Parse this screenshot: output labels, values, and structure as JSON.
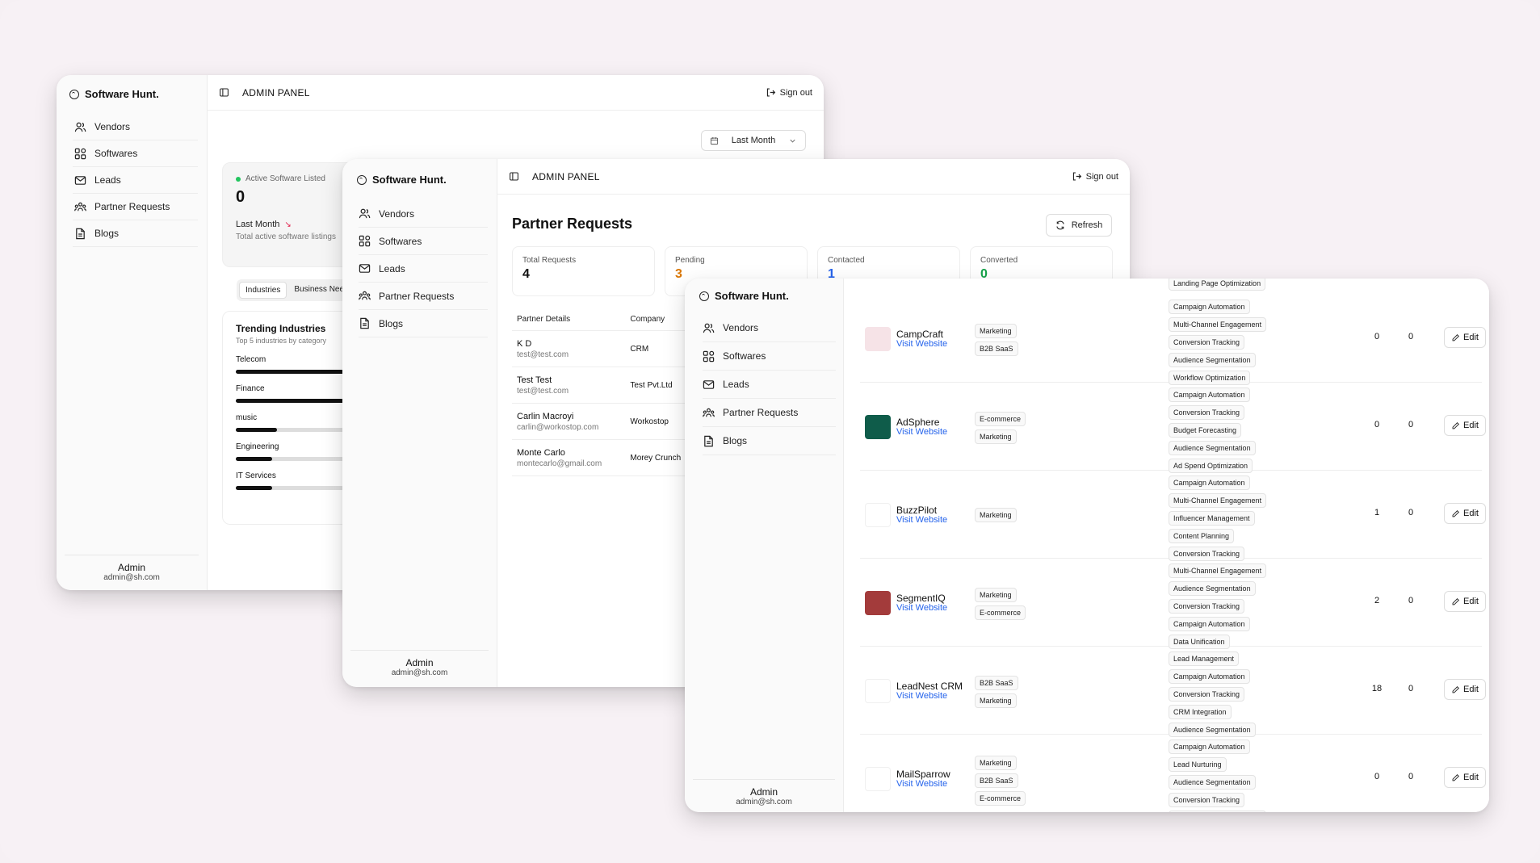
{
  "brand": "Software Hunt.",
  "nav": [
    "Vendors",
    "Softwares",
    "Leads",
    "Partner Requests",
    "Blogs"
  ],
  "header": {
    "panel_title": "ADMIN PANEL",
    "signout": "Sign out"
  },
  "user": {
    "name": "Admin",
    "email": "admin@sh.com"
  },
  "dashboard": {
    "date_filter": "Last Month",
    "active_card": {
      "label": "Active Software Listed",
      "value": "0",
      "period": "Last Month",
      "subtitle": "Total active software listings"
    },
    "tabs": [
      "Industries",
      "Business Nee"
    ],
    "trending": {
      "title": "Trending Industries",
      "subtitle": "Top 5 industries by category",
      "items": [
        {
          "name": "Telecom",
          "fill": 1.0
        },
        {
          "name": "Finance",
          "fill": 1.0
        },
        {
          "name": "music",
          "fill": 0.34
        },
        {
          "name": "Engineering",
          "fill": 0.3
        },
        {
          "name": "IT Services",
          "fill": 0.3
        }
      ]
    }
  },
  "partner_requests": {
    "title": "Partner Requests",
    "refresh": "Refresh",
    "stats": [
      {
        "label": "Total Requests",
        "value": "4",
        "color": "#111111"
      },
      {
        "label": "Pending",
        "value": "3",
        "color": "#d97706"
      },
      {
        "label": "Contacted",
        "value": "1",
        "color": "#2563eb"
      },
      {
        "label": "Converted",
        "value": "0",
        "color": "#16a34a"
      }
    ],
    "columns": [
      "Partner Details",
      "Company"
    ],
    "rows": [
      {
        "name": "K D",
        "email": "test@test.com",
        "company": "CRM"
      },
      {
        "name": "Test Test",
        "email": "test@test.com",
        "company": "Test Pvt.Ltd"
      },
      {
        "name": "Carlin Macroyi",
        "email": "carlin@workostop.com",
        "company": "Workostop"
      },
      {
        "name": "Monte Carlo",
        "email": "montecarlo@gmail.com",
        "company": "Morey Crunch"
      }
    ]
  },
  "softwares": {
    "top_overflow_feature": "Landing Page Optimization",
    "edit_label": "Edit",
    "link_label": "Visit Website",
    "rows": [
      {
        "name": "CampCraft",
        "logo_color": "#f6e3e7",
        "categories": [
          "Marketing",
          "B2B SaaS"
        ],
        "features": [
          "Campaign Automation",
          "Multi-Channel Engagement",
          "Conversion Tracking",
          "Audience Segmentation",
          "Workflow Optimization"
        ],
        "col1": "0",
        "col2": "0",
        "flag": true
      },
      {
        "name": "AdSphere",
        "logo_color": "#0f5c4a",
        "categories": [
          "E-commerce",
          "Marketing"
        ],
        "features": [
          "Campaign Automation",
          "Conversion Tracking",
          "Budget Forecasting",
          "Audience Segmentation",
          "Ad Spend Optimization"
        ],
        "col1": "0",
        "col2": "0",
        "flag": true
      },
      {
        "name": "BuzzPilot",
        "logo_color": "#ffffff",
        "categories": [
          "Marketing"
        ],
        "features": [
          "Campaign Automation",
          "Multi-Channel Engagement",
          "Influencer Management",
          "Content Planning",
          "Conversion Tracking"
        ],
        "col1": "1",
        "col2": "0",
        "flag": true
      },
      {
        "name": "SegmentIQ",
        "logo_color": "#a33b3b",
        "categories": [
          "Marketing",
          "E-commerce"
        ],
        "features": [
          "Multi-Channel Engagement",
          "Audience Segmentation",
          "Conversion Tracking",
          "Campaign Automation",
          "Data Unification"
        ],
        "col1": "2",
        "col2": "0",
        "flag": true
      },
      {
        "name": "LeadNest CRM",
        "logo_color": "#ffffff",
        "categories": [
          "B2B SaaS",
          "Marketing"
        ],
        "features": [
          "Lead Management",
          "Campaign Automation",
          "Conversion Tracking",
          "CRM Integration",
          "Audience Segmentation"
        ],
        "col1": "18",
        "col2": "0",
        "flag": false
      },
      {
        "name": "MailSparrow",
        "logo_color": "#ffffff",
        "categories": [
          "Marketing",
          "B2B SaaS",
          "E-commerce"
        ],
        "features": [
          "Campaign Automation",
          "Lead Nurturing",
          "Audience Segmentation",
          "Conversion Tracking",
          "Multi-Channel Engagement"
        ],
        "col1": "0",
        "col2": "0",
        "flag": false
      }
    ]
  }
}
